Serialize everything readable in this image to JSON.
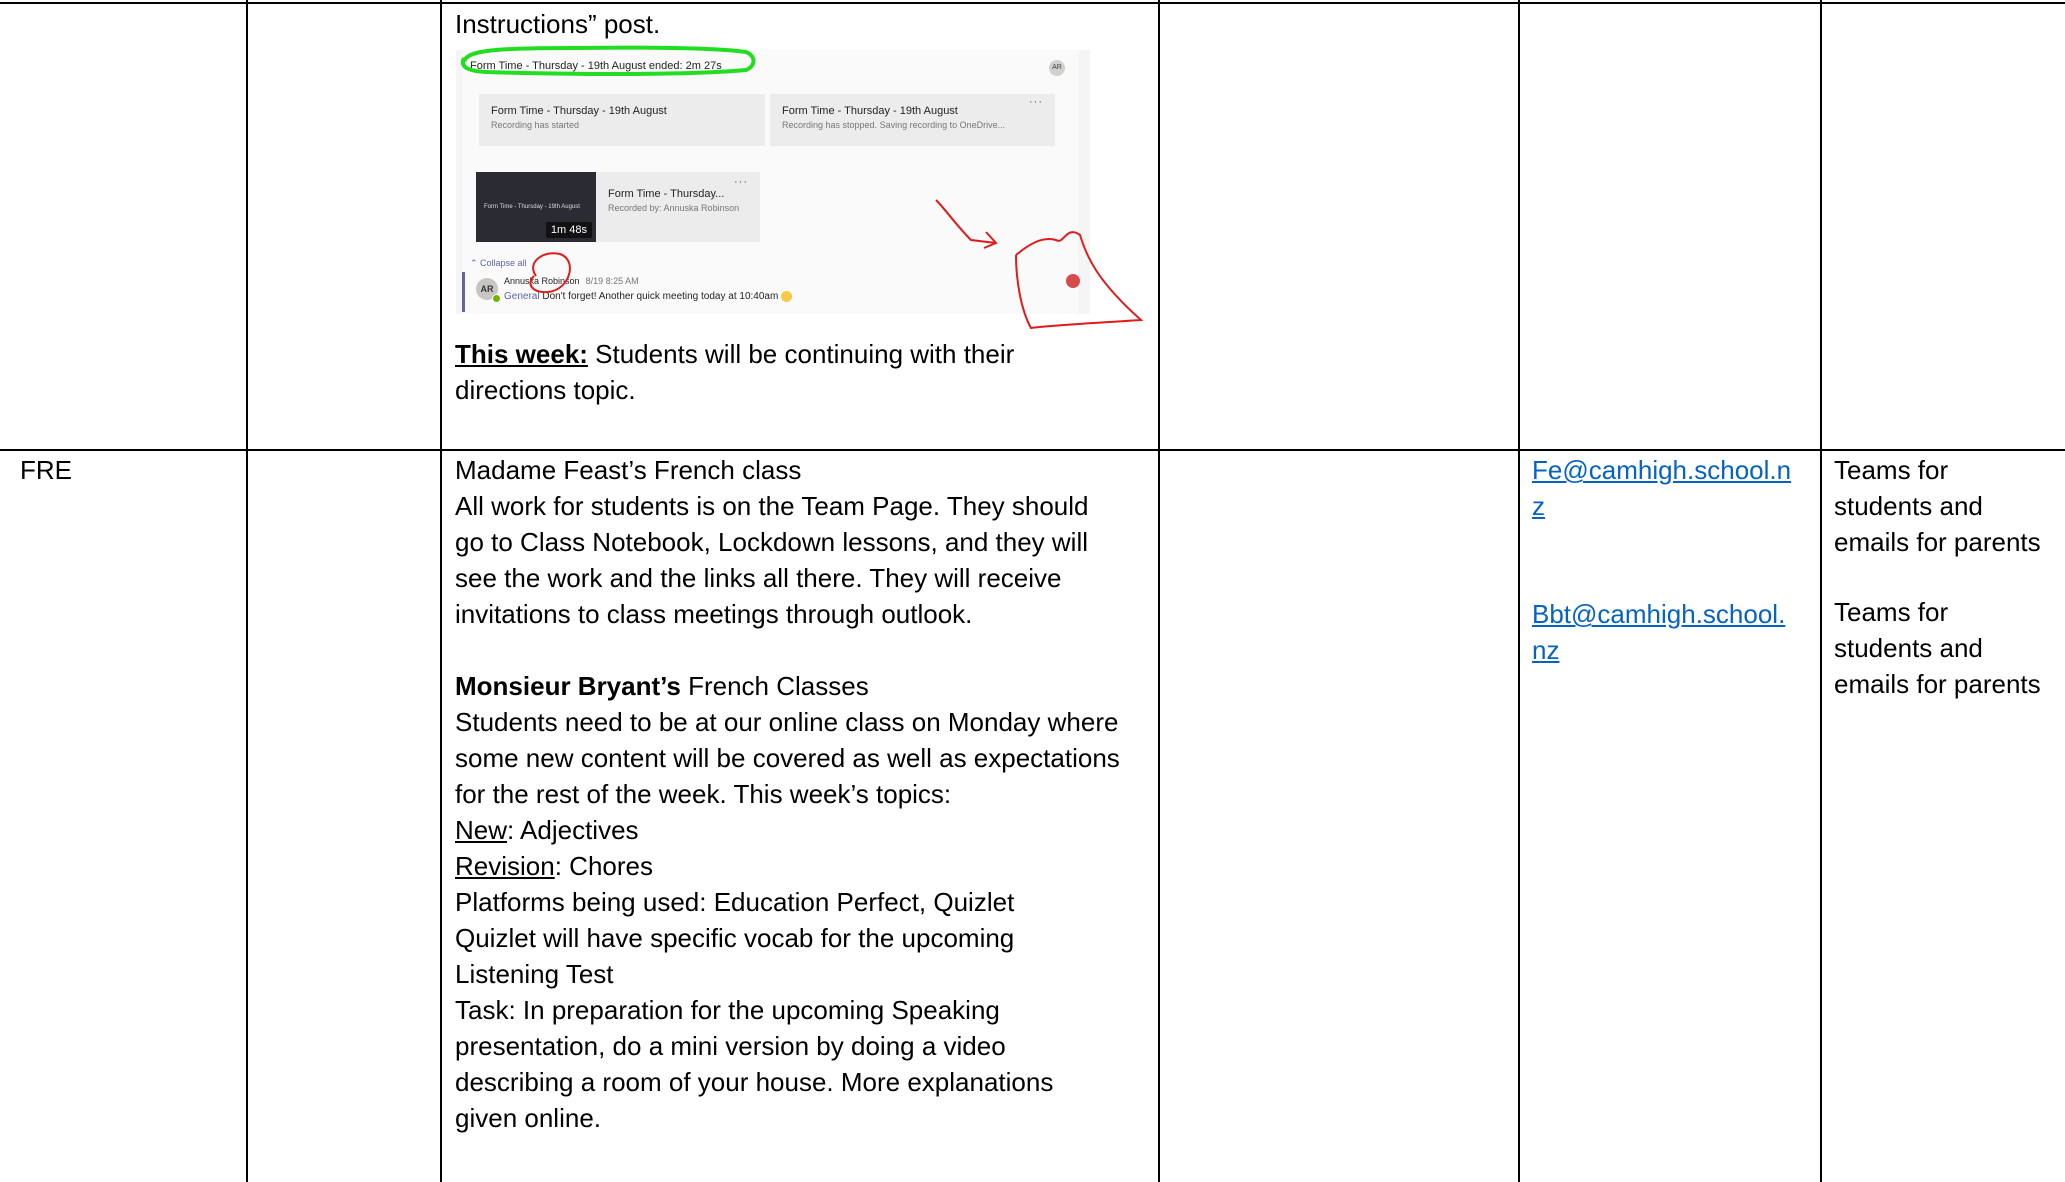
{
  "top_row": {
    "instructions_tail": "Instructions” post.",
    "screenshot": {
      "header": "Form Time - Thursday - 19th August ended: 2m 27s",
      "header_avatar": "AR",
      "card1": {
        "title": "Form Time - Thursday - 19th August",
        "subtitle": "Recording has started"
      },
      "card2": {
        "title": "Form Time - Thursday - 19th August",
        "subtitle": "Recording has stopped. Saving recording to OneDrive...",
        "menu": "···"
      },
      "thumb_title": "Form Time - Thursday - 19th August",
      "thumb_duration": "1m 48s",
      "card3": {
        "title": "Form Time - Thursday...",
        "subtitle": "Recorded by: Annuska Robinson",
        "menu": "···"
      },
      "collapse": "⌃ Collapse all",
      "avatar": "AR",
      "sender": "Annuska Robinson",
      "sent_time": "8/19 8:25 AM",
      "channel": "General",
      "message": "Don't forget! Another quick meeting today at 10:40am"
    },
    "this_week_label": "This week:",
    "this_week_line1": " Students will be continuing with their",
    "this_week_line2": "directions topic."
  },
  "fre_row": {
    "subject": "FRE",
    "feast_heading": "Madame Feast’s French class",
    "feast_lines": [
      "All work for students is on the Team Page.  They should",
      "go to Class Notebook, Lockdown lessons, and they will",
      "see the work and the links all there. They will receive",
      "invitations to class meetings through outlook."
    ],
    "bryant_name": "Monsieur Bryant’s",
    "bryant_rest": " French Classes",
    "bryant_lines": [
      "Students need to be at our online class on Monday where",
      "some new content will be covered as well as expectations",
      "for the rest of the week. This week’s topics:"
    ],
    "new_label": "New",
    "new_value": ": Adjectives",
    "revision_label": "Revision",
    "revision_value": ": Chores",
    "tail_lines": [
      "Platforms being used: Education Perfect, Quizlet",
      "Quizlet will have specific vocab for the upcoming",
      "Listening Test",
      "Task: In preparation for the upcoming Speaking",
      "presentation, do a mini version by doing a video",
      "describing a room of your house. More explanations",
      "given online."
    ],
    "email1_line1": "Fe@camhigh.school.n",
    "email1_line2": "z",
    "email2_line1": "Bbt@camhigh.school.",
    "email2_line2": "nz",
    "contact1": [
      "Teams for",
      "students and",
      "emails for parents"
    ],
    "contact2": [
      "Teams for",
      "students and",
      "emails for parents"
    ]
  }
}
